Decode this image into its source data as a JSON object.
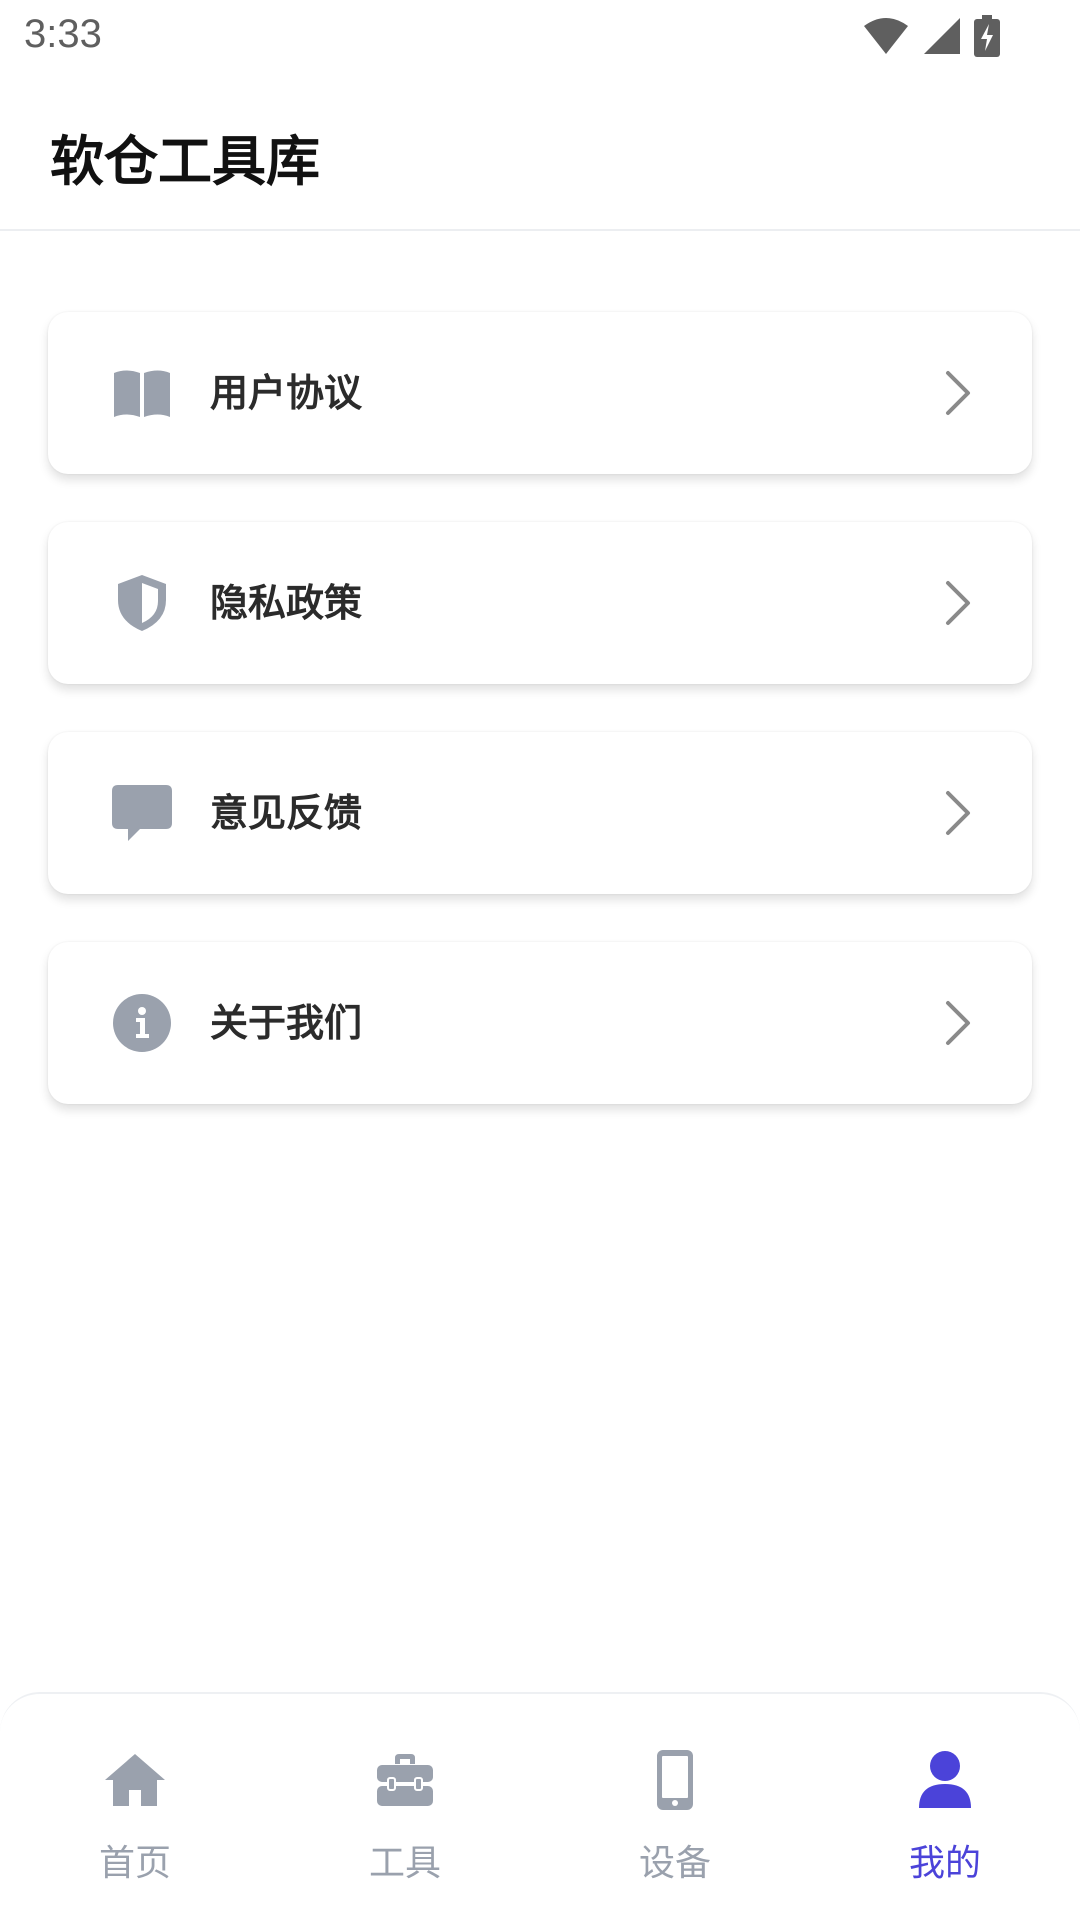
{
  "status": {
    "time": "3:33"
  },
  "header": {
    "title": "软仓工具库"
  },
  "menu": {
    "items": [
      {
        "label": "用户协议",
        "icon": "book-icon"
      },
      {
        "label": "隐私政策",
        "icon": "shield-icon"
      },
      {
        "label": "意见反馈",
        "icon": "comment-icon"
      },
      {
        "label": "关于我们",
        "icon": "info-icon"
      }
    ]
  },
  "nav": {
    "items": [
      {
        "label": "首页",
        "icon": "home-icon",
        "active": false
      },
      {
        "label": "工具",
        "icon": "toolbox-icon",
        "active": false
      },
      {
        "label": "设备",
        "icon": "phone-icon",
        "active": false
      },
      {
        "label": "我的",
        "icon": "user-icon",
        "active": true
      }
    ]
  },
  "colors": {
    "icon_gray": "#9aa1ad",
    "active": "#4b43d9",
    "text": "#2b2b2b"
  }
}
